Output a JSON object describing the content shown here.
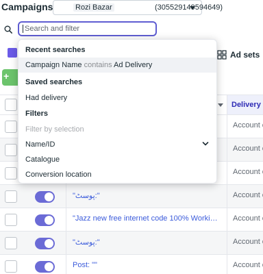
{
  "header": {
    "title": "Campaigns",
    "account_name": "Rozi Bazar",
    "account_id": "(305529149594649)"
  },
  "search": {
    "placeholder": "Search and filter"
  },
  "tabs": {
    "ad_sets": "Ad sets"
  },
  "create_button": {
    "label": "+"
  },
  "table": {
    "sorted_column": "Delivery ↑",
    "rows": [
      {
        "name": "",
        "delivery": "Account c",
        "toggle": "off"
      },
      {
        "name": "",
        "delivery": "Account c",
        "toggle": "off"
      },
      {
        "name": "",
        "delivery": "Account c",
        "toggle": "off"
      },
      {
        "name": "\"پوسٹ:\"",
        "delivery": "Account c",
        "toggle": "on"
      },
      {
        "name": "\"Jazz new free internet code 100% Working \" :...",
        "delivery": "Account c",
        "toggle": "on"
      },
      {
        "name": "\"پوسٹ:\"",
        "delivery": "Account c",
        "toggle": "on"
      },
      {
        "name": "Post: \"\"",
        "delivery": "Account c",
        "toggle": "on"
      }
    ]
  },
  "dropdown": {
    "recent_header": "Recent searches",
    "recent_field": "Campaign Name",
    "recent_op": "contains",
    "recent_value": "Ad Delivery",
    "saved_header": "Saved searches",
    "saved_item": "Had delivery",
    "filters_header": "Filters",
    "filter_placeholder": "Filter by selection",
    "filter_items": [
      "Name/ID",
      "Catalogue",
      "Conversion location"
    ]
  },
  "colors": {
    "accent": "#5e5cd1",
    "toggle_on": "#6b6bd6",
    "link": "#3b5bdb",
    "create_green": "#6cc46c"
  }
}
